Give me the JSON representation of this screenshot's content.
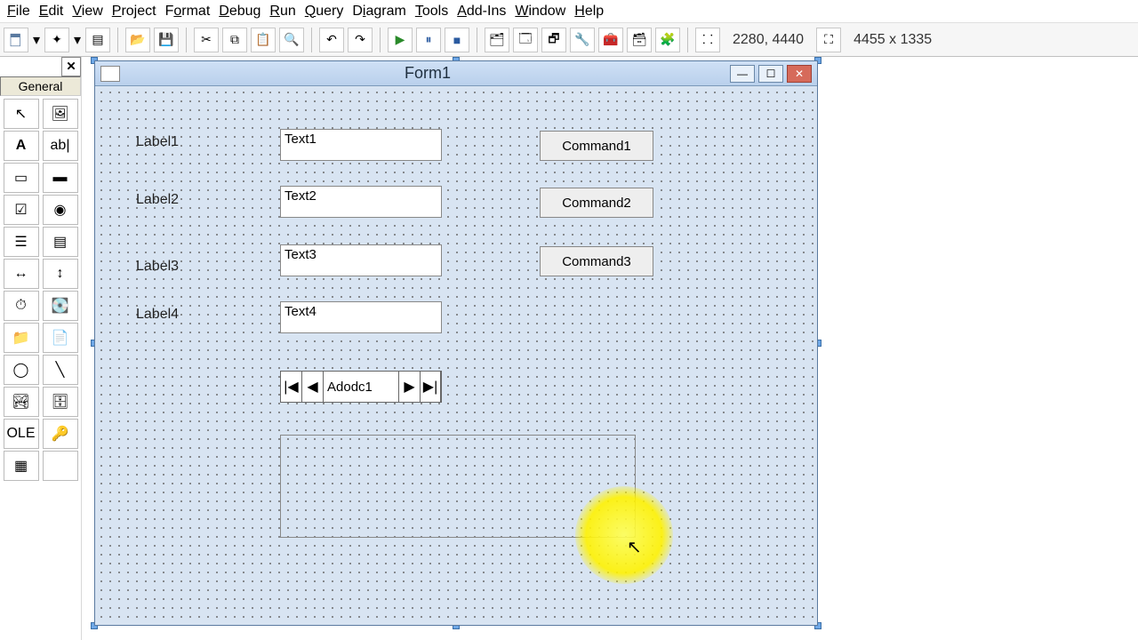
{
  "menu": {
    "items": [
      "File",
      "Edit",
      "View",
      "Project",
      "Format",
      "Debug",
      "Run",
      "Query",
      "Diagram",
      "Tools",
      "Add-Ins",
      "Window",
      "Help"
    ]
  },
  "status": {
    "coords": "2280, 4440",
    "size": "4455 x 1335"
  },
  "toolbox": {
    "title": "General"
  },
  "form": {
    "title": "Form1",
    "labels": [
      "Label1",
      "Label2",
      "Label3",
      "Label4"
    ],
    "texts": [
      "Text1",
      "Text2",
      "Text3",
      "Text4"
    ],
    "commands": [
      "Command1",
      "Command2",
      "Command3"
    ],
    "adodc": "Adodc1"
  }
}
